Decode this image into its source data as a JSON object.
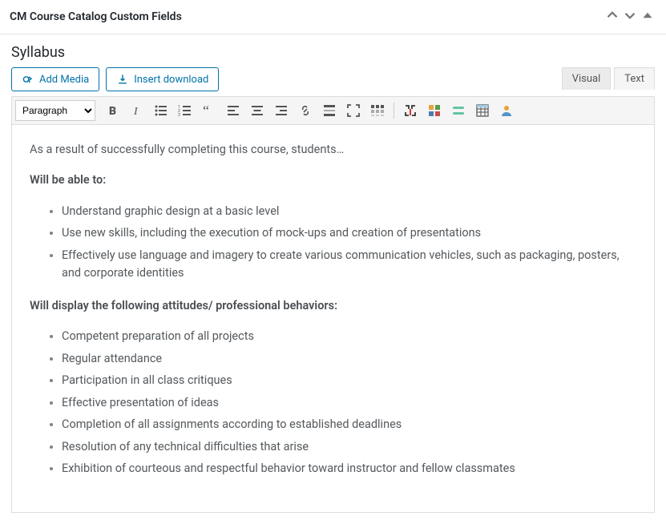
{
  "panel": {
    "title": "CM Course Catalog Custom Fields"
  },
  "field": {
    "label": "Syllabus"
  },
  "buttons": {
    "add_media": "Add Media",
    "insert_download": "Insert download"
  },
  "tabs": {
    "visual": "Visual",
    "text": "Text"
  },
  "format_select": "Paragraph",
  "content": {
    "intro": "As a result of successfully completing this course, students…",
    "heading_able": "Will be able to:",
    "able_items": [
      "Understand graphic design at a basic level",
      "Use new skills, including the execution of mock-ups and creation of presentations",
      "Effectively use language and imagery to create various communication vehicles, such as packaging, posters, and corporate identities"
    ],
    "heading_attitudes": "Will display the following attitudes/ professional behaviors:",
    "attitude_items": [
      "Competent preparation of all projects",
      "Regular attendance",
      "Participation in all class critiques",
      "Effective presentation of ideas",
      "Completion of all assignments according to established deadlines",
      "Resolution of any technical difficulties that arise",
      "Exhibition of courteous and respectful behavior toward instructor and fellow classmates"
    ]
  }
}
